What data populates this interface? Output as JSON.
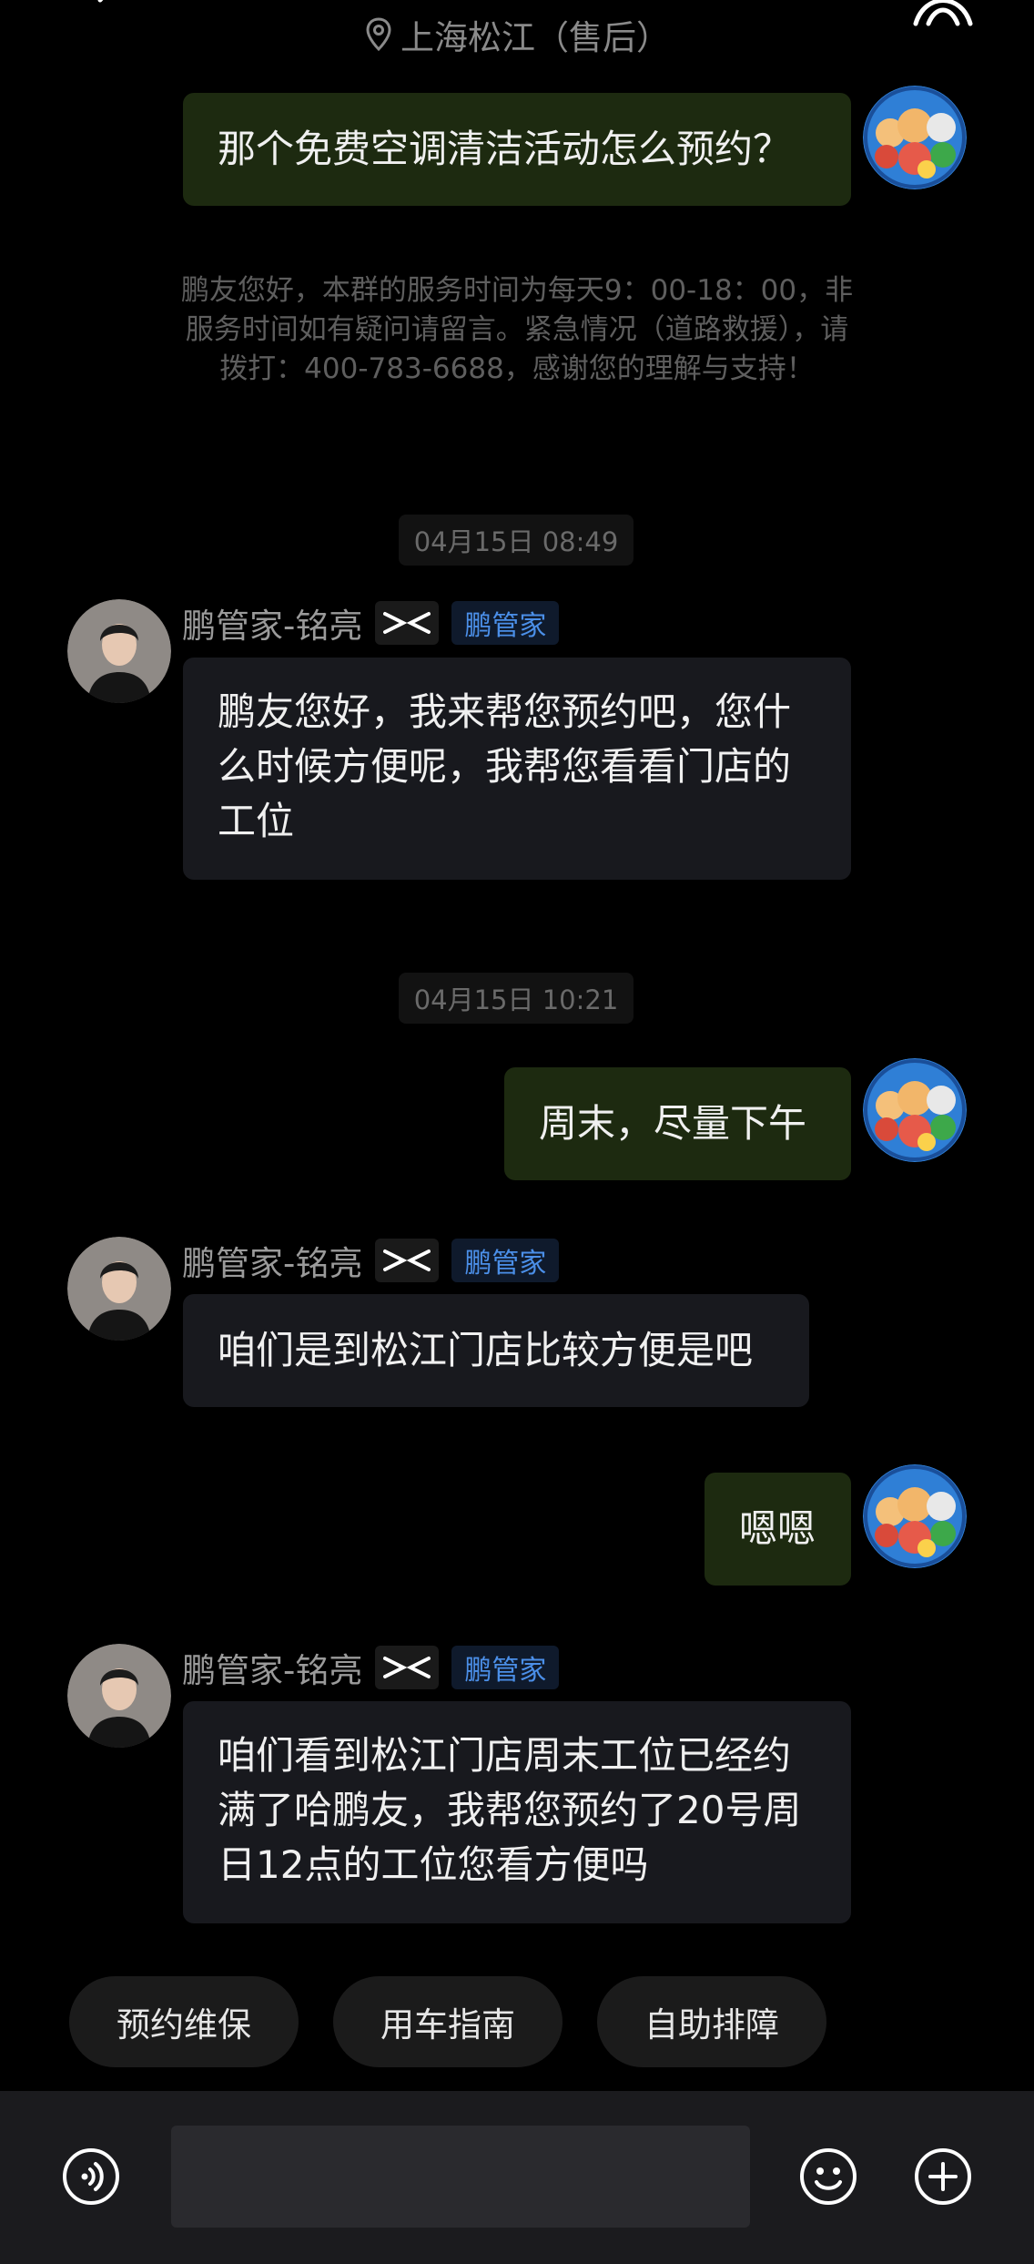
{
  "header": {
    "location": "上海松江（售后）"
  },
  "messages": {
    "user_1": "那个免费空调清洁活动怎么预约？",
    "notice": "鹏友您好，本群的服务时间为每天9：00-18：00，非服务时间如有疑问请留言。紧急情况（道路救援），请拨打：400-783-6688，感谢您的理解与支持！",
    "time_1": "04月15日 08:49",
    "agent_1": "鹏友您好，我来帮您预约吧，您什么时候方便呢，我帮您看看门店的工位",
    "time_2": "04月15日 10:21",
    "user_2": "周末，尽量下午",
    "agent_2": "咱们是到松江门店比较方便是吧",
    "user_3": "嗯嗯",
    "agent_3": "咱们看到松江门店周末工位已经约满了哈鹏友，我帮您预约了20号周日12点的工位您看方便吗"
  },
  "sender": {
    "name": "鹏管家-铭亮",
    "role": "鹏管家"
  },
  "quick_replies": [
    "预约维保",
    "用车指南",
    "自助排障"
  ],
  "input": {
    "value": ""
  },
  "icons": {
    "voice": "voice-icon",
    "emoji": "emoji-icon",
    "plus": "plus-icon",
    "back": "back-icon",
    "location": "location-pin-icon",
    "brand": "xpeng-logo-icon"
  },
  "colors": {
    "background": "#000000",
    "user_bubble": "#1d2a10",
    "agent_bubble": "#18191e",
    "role_badge_text": "#4b8fe8",
    "bottom_bar": "#1b1b1e"
  }
}
